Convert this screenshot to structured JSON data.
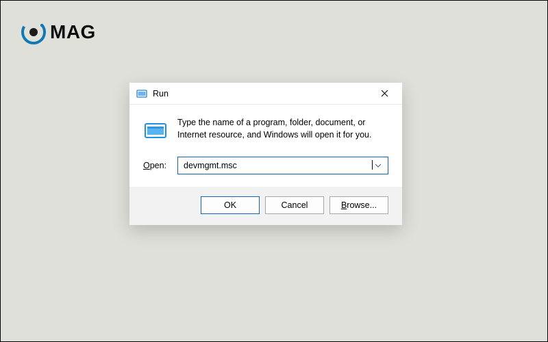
{
  "logo": {
    "text": "MAG"
  },
  "dialog": {
    "title": "Run",
    "description": "Type the name of a program, folder, document, or Internet resource, and Windows will open it for you.",
    "open_label_pre": "O",
    "open_label_post": "pen:",
    "combo_value": "devmgmt.msc",
    "buttons": {
      "ok": "OK",
      "cancel": "Cancel",
      "browse_pre": "B",
      "browse_post": "rowse..."
    }
  }
}
